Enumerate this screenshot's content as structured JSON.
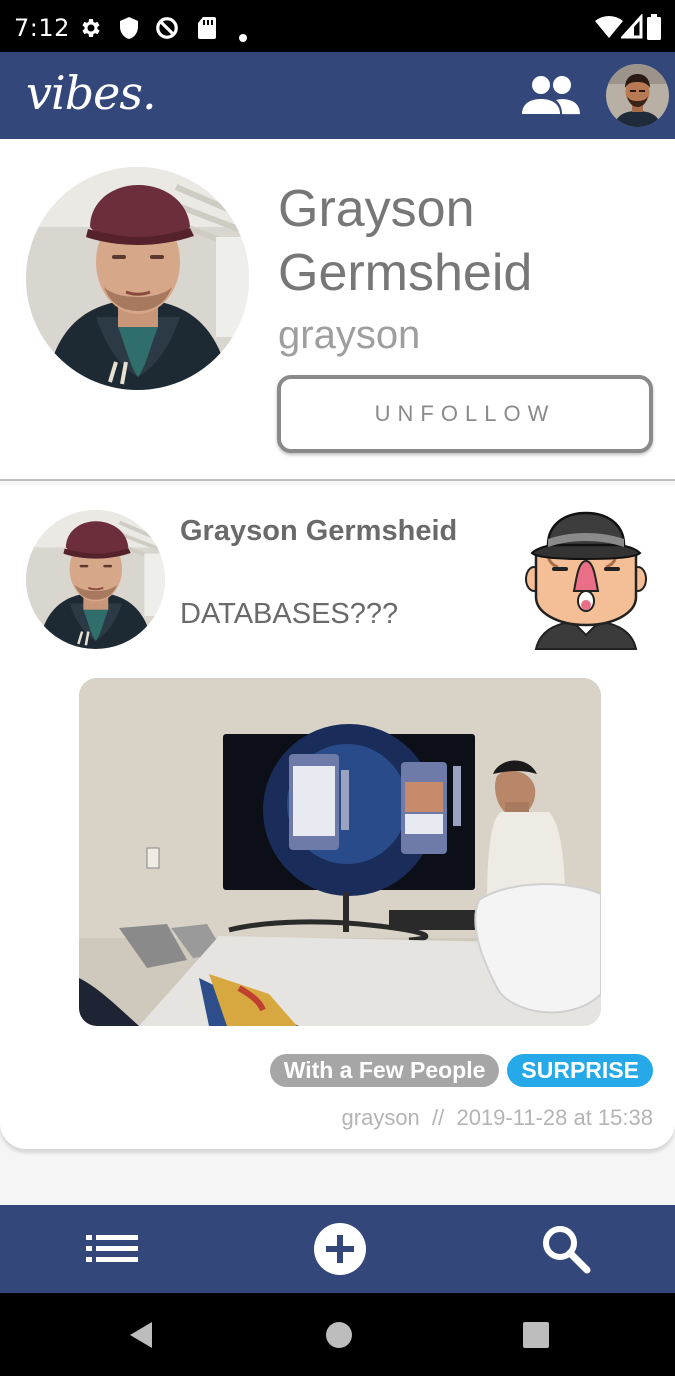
{
  "status_bar": {
    "time": "7:12"
  },
  "app_bar": {
    "logo": "vibes."
  },
  "profile": {
    "name": "Grayson Germsheid",
    "username": "grayson",
    "unfollow_label": "UNFOLLOW"
  },
  "post": {
    "author": "Grayson Germsheid",
    "text": "DATABASES???",
    "tags": [
      "With a Few People",
      "SURPRISE"
    ],
    "meta": "grayson  //  2019-11-28 at 15:38"
  },
  "icons": {
    "friends": "people-icon",
    "feed": "list-icon",
    "add": "add-circle-icon",
    "search": "search-icon"
  },
  "colors": {
    "brand": "#34477a",
    "tag_grey": "#a6a6a6",
    "tag_blue": "#26a9e8"
  }
}
